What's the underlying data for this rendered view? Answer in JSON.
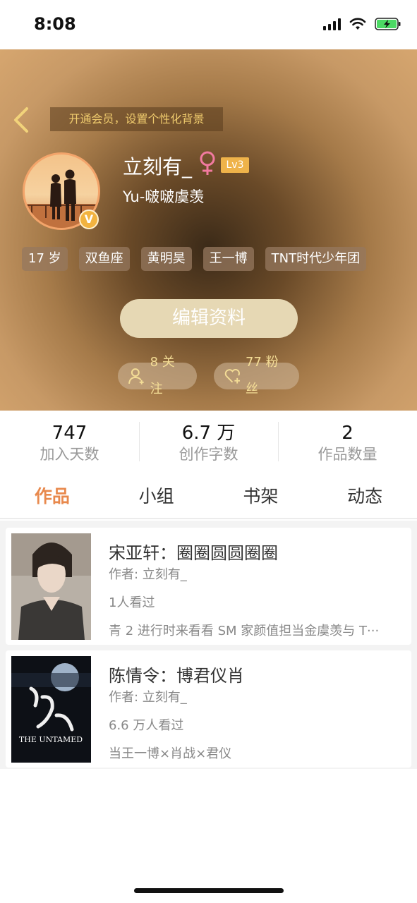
{
  "status_bar": {
    "time": "8:08",
    "icons": [
      "signal-icon",
      "wifi-icon",
      "battery-charging-icon"
    ]
  },
  "header": {
    "vip_banner": "开通会员，设置个性化背景",
    "username": "立刻有_",
    "gender_symbol": "♀",
    "level": "Lv3",
    "vip_badge": "V",
    "subname": "Yu-啵啵虞羡",
    "tags": [
      "17 岁",
      "双鱼座",
      "黄明昊",
      "王一博",
      "TNT时代少年团"
    ],
    "edit_button": "编辑资料",
    "follow_label": "8 关注",
    "fans_label": "77 粉丝"
  },
  "stats": [
    {
      "value": "747",
      "label": "加入天数"
    },
    {
      "value": "6.7 万",
      "label": "创作字数"
    },
    {
      "value": "2",
      "label": "作品数量"
    }
  ],
  "tabs": [
    {
      "label": "作品",
      "active": true
    },
    {
      "label": "小组",
      "active": false
    },
    {
      "label": "书架",
      "active": false
    },
    {
      "label": "动态",
      "active": false
    }
  ],
  "works": [
    {
      "title": "宋亚轩：圈圈圆圆圈圈",
      "author": "作者: 立刻有_",
      "views": "1人看过",
      "desc": "青 2 进行时来看看 SM 家颜值担当金虞羡与 T···"
    },
    {
      "title": "陈情令：博君仪肖",
      "author": "作者: 立刻有_",
      "views": "6.6 万人看过",
      "desc": "当王一博×肖战×君仪",
      "cover_text": "THE UNTAMED"
    }
  ],
  "colors": {
    "accent": "#e8894d",
    "level_badge": "#efb34a",
    "vip_text": "#f0cc6e"
  }
}
